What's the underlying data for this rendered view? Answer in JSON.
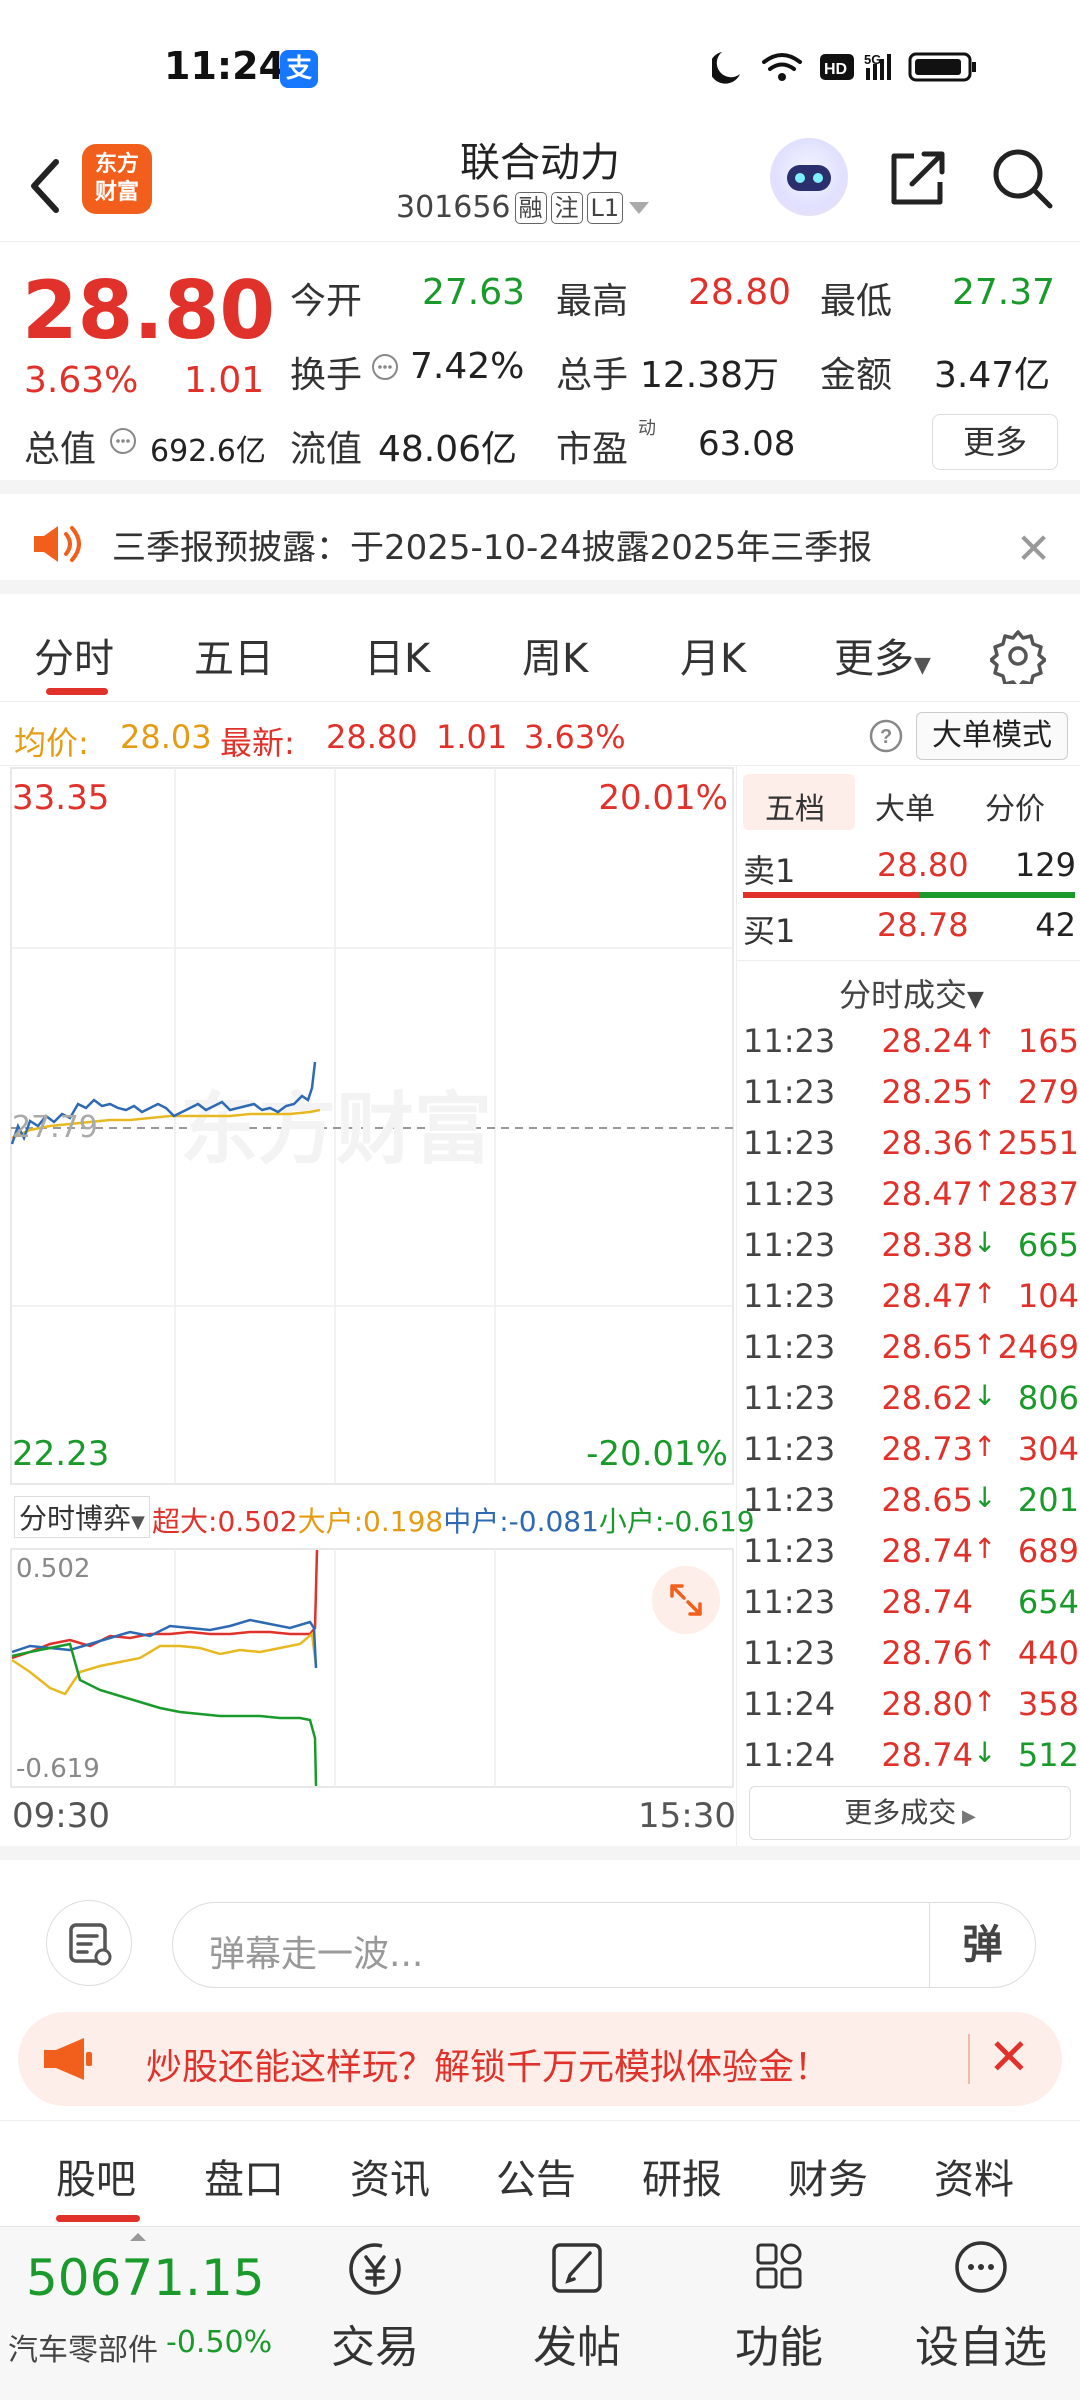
{
  "status_bar": {
    "time": "11:24",
    "alipay_glyph": "支"
  },
  "header": {
    "logo_line1": "东方",
    "logo_line2": "财富",
    "stock_name": "联合动力",
    "stock_code": "301656",
    "tag_margin": "融",
    "tag_watch": "注",
    "tag_level": "L1"
  },
  "quote": {
    "price": "28.80",
    "pct_change": "3.63%",
    "change": "1.01",
    "open_label": "今开",
    "open_value": "27.63",
    "high_label": "最高",
    "high_value": "28.80",
    "low_label": "最低",
    "low_value": "27.37",
    "turnover_label": "换手",
    "turnover_value": "7.42%",
    "volume_label": "总手",
    "volume_value": "12.38万",
    "amount_label": "金额",
    "amount_value": "3.47亿",
    "mktcap_label": "总值",
    "mktcap_value": "692.6亿",
    "float_label": "流值",
    "float_value": "48.06亿",
    "pe_label": "市盈",
    "pe_sup": "动",
    "pe_value": "63.08",
    "more_label": "更多"
  },
  "notice": {
    "text": "三季报预披露：于2025-10-24披露2025年三季报"
  },
  "chart_tabs": [
    "分时",
    "五日",
    "日K",
    "周K",
    "月K",
    "更多"
  ],
  "info_line": {
    "avg_label": "均价:",
    "avg_value": "28.03",
    "latest_label": "最新:",
    "latest_value": "28.80",
    "latest_change": "1.01",
    "latest_pct": "3.63%",
    "big_order_mode": "大单模式"
  },
  "chart": {
    "y_top": "33.35",
    "y_bottom": "22.23",
    "pct_top": "20.01%",
    "pct_bottom": "-20.01%",
    "prev_close": "27.79",
    "watermark": "东方财富",
    "time_start": "09:30",
    "time_end": "15:30",
    "flow_selector": "分时博弈",
    "flow_super_label": "超大:",
    "flow_super": "0.502",
    "flow_large_label": "大户:",
    "flow_large": "0.198",
    "flow_mid_label": "中户:",
    "flow_mid": "-0.081",
    "flow_small_label": "小户:",
    "flow_small": "-0.619",
    "flow_max": "0.502",
    "flow_min": "-0.619"
  },
  "order_panel": {
    "tabs": [
      "五档",
      "大单",
      "分价"
    ],
    "sell1_label": "卖1",
    "sell1_price": "28.80",
    "sell1_vol": "129",
    "buy1_label": "买1",
    "buy1_price": "28.78",
    "buy1_vol": "42",
    "trades_header": "分时成交",
    "more_trades": "更多成交",
    "trades": [
      {
        "time": "11:23",
        "price": "28.24",
        "dir": "up",
        "vol": "165"
      },
      {
        "time": "11:23",
        "price": "28.25",
        "dir": "up",
        "vol": "279"
      },
      {
        "time": "11:23",
        "price": "28.36",
        "dir": "up",
        "vol": "2551"
      },
      {
        "time": "11:23",
        "price": "28.47",
        "dir": "up",
        "vol": "2837"
      },
      {
        "time": "11:23",
        "price": "28.38",
        "dir": "down",
        "vol": "665"
      },
      {
        "time": "11:23",
        "price": "28.47",
        "dir": "up",
        "vol": "104"
      },
      {
        "time": "11:23",
        "price": "28.65",
        "dir": "up",
        "vol": "2469"
      },
      {
        "time": "11:23",
        "price": "28.62",
        "dir": "down",
        "vol": "806"
      },
      {
        "time": "11:23",
        "price": "28.73",
        "dir": "up",
        "vol": "304"
      },
      {
        "time": "11:23",
        "price": "28.65",
        "dir": "down",
        "vol": "201"
      },
      {
        "time": "11:23",
        "price": "28.74",
        "dir": "up",
        "vol": "689"
      },
      {
        "time": "11:23",
        "price": "28.74",
        "dir": "none",
        "vol": "654"
      },
      {
        "time": "11:23",
        "price": "28.76",
        "dir": "up",
        "vol": "440"
      },
      {
        "time": "11:24",
        "price": "28.80",
        "dir": "up",
        "vol": "358"
      },
      {
        "time": "11:24",
        "price": "28.74",
        "dir": "down",
        "vol": "512"
      }
    ]
  },
  "danmaku": {
    "placeholder": "弹幕走一波...",
    "send_label": "弹"
  },
  "promo": {
    "text": "炒股还能这样玩？解锁千万元模拟体验金！"
  },
  "bottom_tabs": [
    "股吧",
    "盘口",
    "资讯",
    "公告",
    "研报",
    "财务",
    "资料"
  ],
  "footer": {
    "index_value": "50671.15",
    "index_name": "汽车零部件",
    "index_pct": "-0.50%",
    "actions": [
      "交易",
      "发帖",
      "功能",
      "设自选"
    ]
  }
}
